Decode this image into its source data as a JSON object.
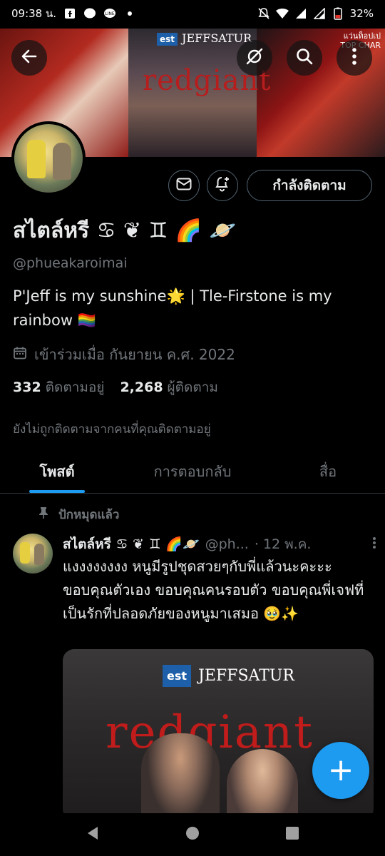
{
  "status_bar": {
    "time": "09:38 น.",
    "battery": "32%"
  },
  "banner": {
    "brand": "JEFFSATUR",
    "brand_badge": "est",
    "title": "redgiant",
    "corner_text_line1": "แว่นท็อปเป",
    "corner_text_line2": "TOP CHAR"
  },
  "profile": {
    "display_name": "สไตล์หรี ♋ ❦ ♊ 🌈 🪐",
    "handle": "@phueakaroimai",
    "bio": "P'Jeff is my sunshine🌟 | Tle-Firstone is my rainbow 🏳️‍🌈",
    "joined": "เข้าร่วมเมื่อ กันยายน ค.ศ. 2022",
    "following_count": "332",
    "following_label": "ติดตามอยู่",
    "followers_count": "2,268",
    "followers_label": "ผู้ติดตาม",
    "not_followed_note": "ยังไม่ถูกติดตามจากคนที่คุณติดตามอยู่",
    "follow_button": "กำลังติดตาม"
  },
  "tabs": [
    {
      "label": "โพสต์",
      "active": true
    },
    {
      "label": "การตอบกลับ",
      "active": false
    },
    {
      "label": "สื่อ",
      "active": false
    }
  ],
  "pinned_label": "ปักหมุดแล้ว",
  "post": {
    "name": "สไตล์หรี ♋ ❦ ♊ 🌈🪐",
    "handle": "@ph...",
    "time": "· 12 พ.ค.",
    "text": "แงงงงงงงง หนูมีรูปชุดสวยๆกับพี่แล้วนะคะะะ ขอบคุณตัวเอง ขอบคุณคนรอบตัว ขอบคุณพี่เจฟที่เป็นรักที่ปลอดภัยของหนูมาเสมอ 🥹✨",
    "media_brand": "JEFFSATUR",
    "media_badge": "est",
    "media_title": "redgiant"
  },
  "fab_label": "+",
  "colors": {
    "accent": "#1d9bf0",
    "background": "#000000",
    "secondary_text": "#71767b"
  },
  "icons": {
    "back": "arrow-left-icon",
    "no_translate": "slashed-circle-icon",
    "search": "search-icon",
    "more": "more-vertical-icon",
    "message": "envelope-icon",
    "notify": "bell-plus-icon",
    "calendar": "calendar-icon",
    "pin": "pin-icon"
  }
}
